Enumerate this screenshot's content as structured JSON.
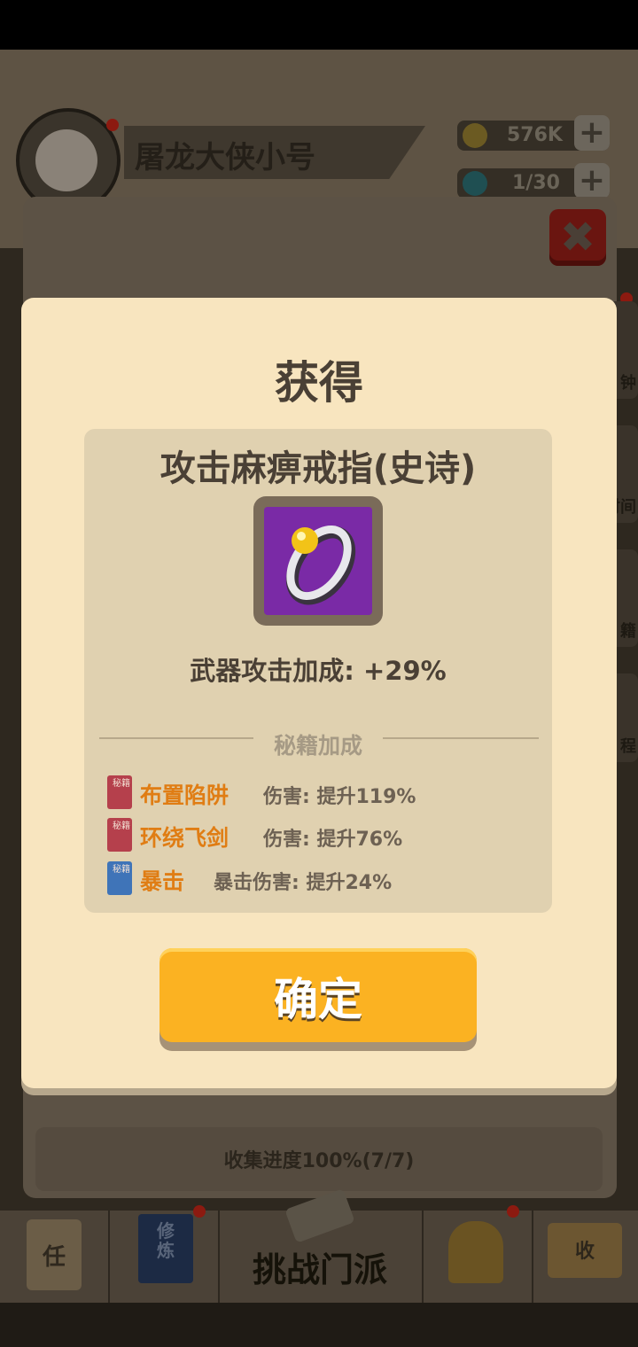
{
  "header": {
    "player_name": "屠龙大侠小号",
    "gold": "576K",
    "stamina": "1/30",
    "plus_glyph": "+",
    "close_glyph": "✖"
  },
  "modal": {
    "title": "获得",
    "item_name": "攻击麻痹戒指(史诗)",
    "stat_label": "武器攻击加成: +29%",
    "bonus_title": "秘籍加成",
    "bonuses": [
      {
        "name": "布置陷阱",
        "desc": "伤害: 提升119%",
        "book_color": "red",
        "book_glyph": "秘籍"
      },
      {
        "name": "环绕飞剑",
        "desc": "伤害: 提升76%",
        "book_color": "red",
        "book_glyph": "秘籍"
      },
      {
        "name": "暴击",
        "desc": "暴击伤害: 提升24%",
        "book_color": "blue",
        "book_glyph": "秘籍"
      }
    ],
    "confirm_label": "确定"
  },
  "background": {
    "collection_progress": "收集进度100%(7/7)",
    "side_tabs": [
      "钟",
      "时间",
      "籍",
      "程"
    ]
  },
  "bottom_nav": {
    "task_icon_glyph": "任",
    "practice_icon_glyph": "修炼",
    "challenge_label": "挑战门派",
    "collect_icon_glyph": "收"
  },
  "colors": {
    "modal_bg": "#f8e5bf",
    "card_bg": "#e0d1b0",
    "confirm_button": "#fbb222",
    "skill_name": "#e07d14",
    "item_icon_bg": "#7a2aa6"
  }
}
